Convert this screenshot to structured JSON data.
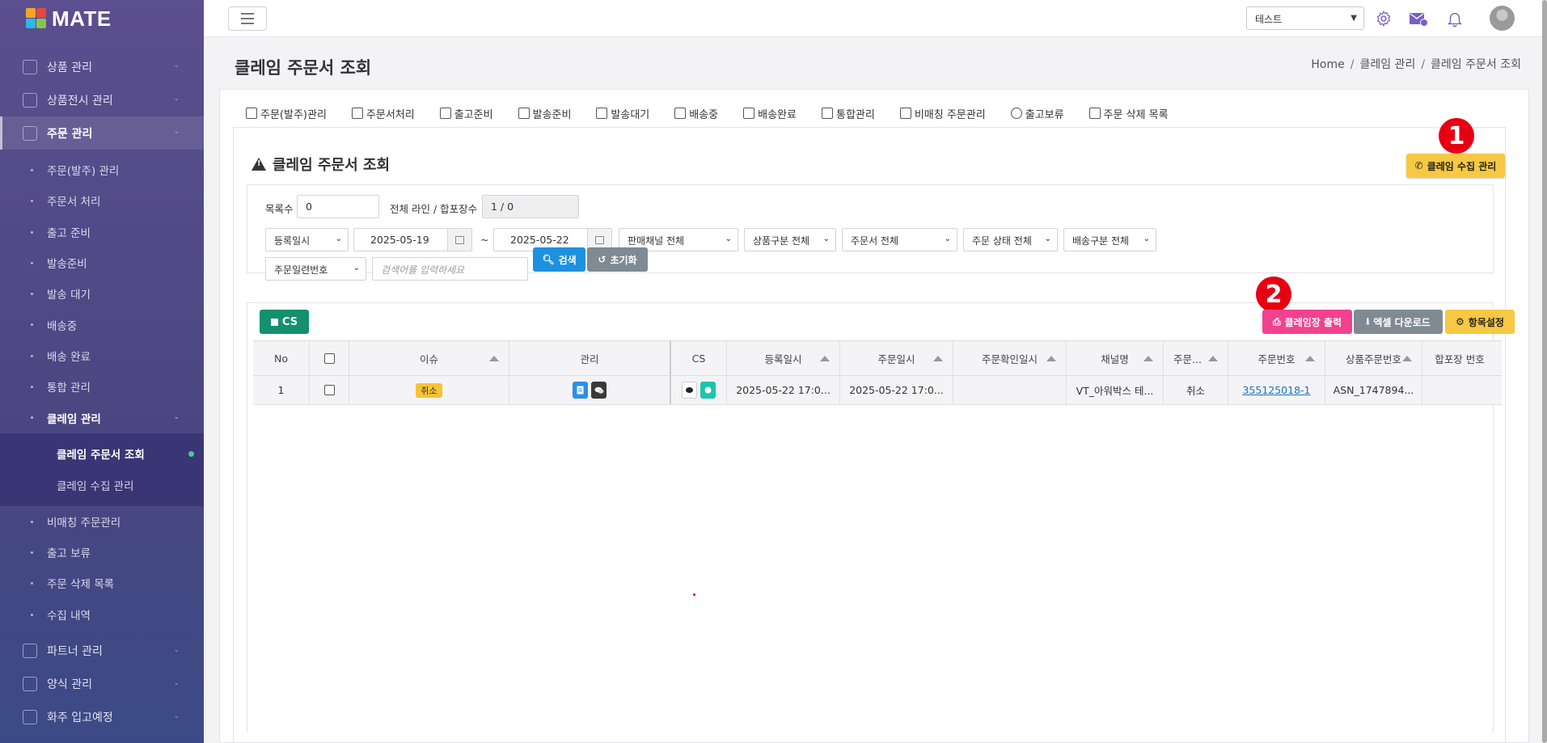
{
  "app": {
    "logo_text": "MATE"
  },
  "sidebar": {
    "groups_top": [
      {
        "label": "상품 관리",
        "icon": "box-icon"
      },
      {
        "label": "상품전시 관리",
        "icon": "store-icon"
      },
      {
        "label": "주문 관리",
        "icon": "cart-icon",
        "active": true
      }
    ],
    "order_items": [
      "주문(발주) 관리",
      "주문서 처리",
      "출고 준비",
      "발송준비",
      "발송 대기",
      "배송중",
      "배송 완료",
      "통합 관리",
      "클레임 관리"
    ],
    "claim_items": [
      "클레임 주문서 조회",
      "클레임 수집 관리"
    ],
    "order_items_after": [
      "비매칭 주문관리",
      "출고 보류",
      "주문 삭제 목록",
      "수집 내역"
    ],
    "groups_bottom": [
      {
        "label": "파트너 관리",
        "icon": "handshake-icon"
      },
      {
        "label": "양식 관리",
        "icon": "document-icon"
      },
      {
        "label": "화주 입고예정",
        "icon": "truck-icon"
      }
    ]
  },
  "topbar": {
    "select_value": "테스트"
  },
  "page": {
    "title": "클레임 주문서 조회",
    "breadcrumb": [
      "Home",
      "클레임 관리",
      "클레임 주문서 조회"
    ]
  },
  "tabs": [
    "주문(발주)관리",
    "주문서처리",
    "출고준비",
    "발송준비",
    "발송대기",
    "배송중",
    "배송완료",
    "통합관리",
    "비매칭 주문관리",
    "출고보류",
    "주문 삭제 목록"
  ],
  "section": {
    "title": "클레임 주문서 조회",
    "claim_collect_button": "클레임 수집 관리",
    "badge_1": "1",
    "badge_2": "2"
  },
  "filters": {
    "list_count_label": "목록수",
    "list_count_value": "0",
    "total_label": "전체 라인 / 합포장수",
    "total_value": "1 / 0",
    "date_type": "등록일시",
    "date_from": "2025-05-19",
    "date_sep": "~",
    "date_to": "2025-05-22",
    "channel": "판매채널 전체",
    "product_type": "상품구분 전체",
    "order_doc": "주문서 전체",
    "order_status": "주문 상태 전체",
    "delivery_type": "배송구분 전체",
    "search_field": "주문일련번호",
    "search_placeholder": "검색어를 입력하세요",
    "search_button": "검색",
    "reset_button": "초기화"
  },
  "toolbar": {
    "cs_button": "CS",
    "print_button": "클레임장 출력",
    "excel_button": "엑셀 다운로드",
    "columns_button": "항목설정"
  },
  "table": {
    "columns": [
      "No",
      "",
      "이슈",
      "관리",
      "CS",
      "등록일시",
      "주문일시",
      "주문확인일시",
      "채널명",
      "주문...",
      "주문번호",
      "상품주문번호",
      "합포장 번호"
    ],
    "rows": [
      {
        "no": "1",
        "issue": "취소",
        "registered": "2025-05-22 17:0...",
        "ordered": "2025-05-22 17:0...",
        "confirmed": "",
        "channel": "VT_아워박스 테...",
        "status": "취소",
        "order_no": "355125018-1",
        "product_order_no": "ASN_1747894...",
        "combined_no": ""
      }
    ]
  },
  "colors": {
    "sidebar_top": "#5b4f8f",
    "sidebar_bottom": "#3b4a86",
    "yellow_button": "#f7c843",
    "pink_button": "#f2418f",
    "gray_button": "#7f8a93",
    "blue_button": "#1e90e0",
    "green_button": "#15906f",
    "badge_red": "#e60012"
  }
}
